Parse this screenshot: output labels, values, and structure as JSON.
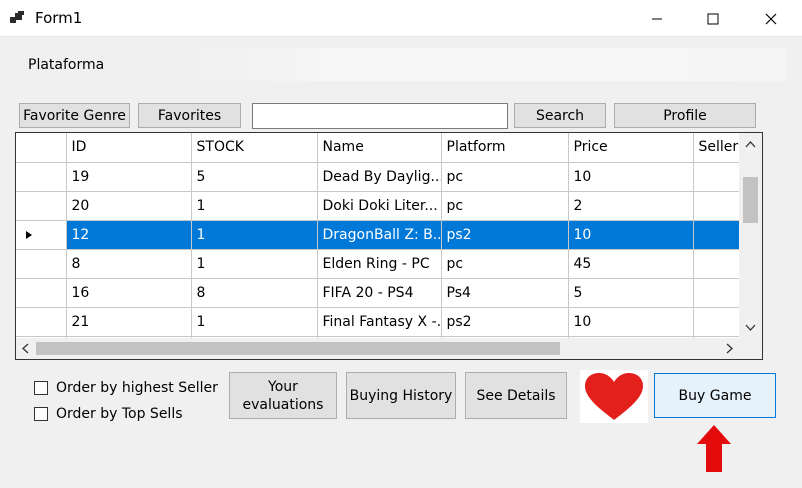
{
  "window": {
    "title": "Form1"
  },
  "menu": {
    "label": "Plataforma"
  },
  "toolbar": {
    "favorite_genre": "Favorite Genre",
    "favorites": "Favorites",
    "search_value": "",
    "search": "Search",
    "profile": "Profile"
  },
  "grid": {
    "columns": [
      "ID",
      "STOCK",
      "Name",
      "Platform",
      "Price",
      "Seller"
    ],
    "rows": [
      {
        "id": "19",
        "stock": "5",
        "name": "Dead By Daylig...",
        "platform": "pc",
        "price": "10"
      },
      {
        "id": "20",
        "stock": "1",
        "name": "Doki Doki Liter...",
        "platform": "pc",
        "price": "2"
      },
      {
        "id": "12",
        "stock": "1",
        "name": "DragonBall Z: B...",
        "platform": "ps2",
        "price": "10"
      },
      {
        "id": "8",
        "stock": "1",
        "name": "Elden Ring - PC",
        "platform": "pc",
        "price": "45"
      },
      {
        "id": "16",
        "stock": "8",
        "name": "FIFA 20 - PS4",
        "platform": "Ps4",
        "price": "5"
      },
      {
        "id": "21",
        "stock": "1",
        "name": "Final Fantasy X -...",
        "platform": "ps2",
        "price": "10"
      }
    ],
    "selected_row_index": 2
  },
  "options": {
    "order_highest_seller": "Order by highest Seller",
    "order_top_sells": "Order by Top Sells"
  },
  "actions": {
    "your_evaluations_line1": "Your",
    "your_evaluations_line2": "evaluations",
    "buying_history": "Buying History",
    "see_details": "See Details",
    "buy_game": "Buy  Game"
  },
  "icons": {
    "app": "app-window-icon",
    "favorite": "heart-icon",
    "pointer": "up-arrow-icon"
  },
  "colors": {
    "selection": "#0078d7",
    "heart": "#e3201b",
    "arrow": "#e30b0b",
    "buy_border": "#0078d7",
    "buy_bg": "#e5f1fb"
  }
}
